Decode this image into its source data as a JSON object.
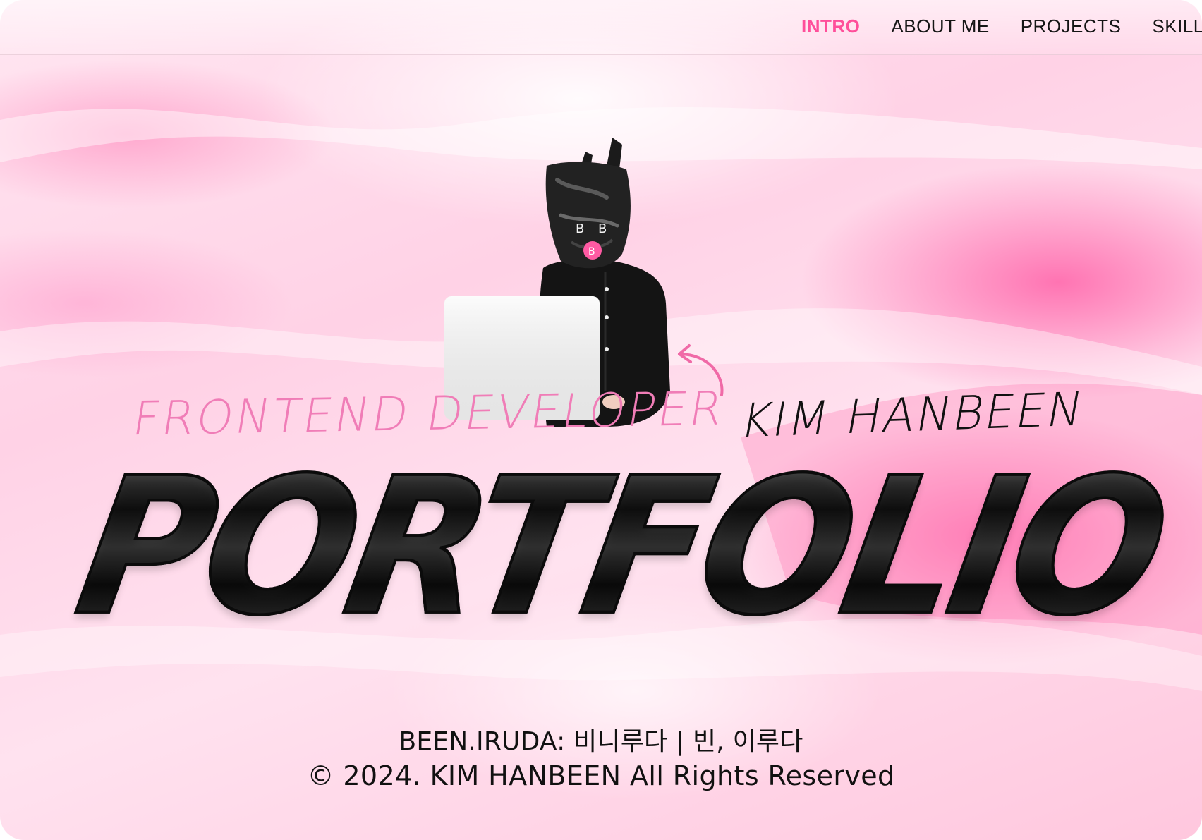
{
  "nav": {
    "items": [
      {
        "label": "INTRO",
        "active": true
      },
      {
        "label": "ABOUT ME",
        "active": false
      },
      {
        "label": "PROJECTS",
        "active": false
      },
      {
        "label": "SKILLS",
        "active": false
      }
    ]
  },
  "hero": {
    "role": "FRONTEND DEVELOPER",
    "name": "KIM HANBEEN",
    "title": "PORTFOLIO",
    "bag_mark": "B B B"
  },
  "footer": {
    "tagline": "BEEN.IRUDA: 비니루다 | 빈, 이루다",
    "copyright": "© 2024. KIM HANBEEN All Rights Reserved"
  },
  "colors": {
    "accent": "#ff4f9a",
    "role_pink": "#f07db7",
    "text_dark": "#111111"
  },
  "icons": [
    "curved-arrow-icon"
  ]
}
